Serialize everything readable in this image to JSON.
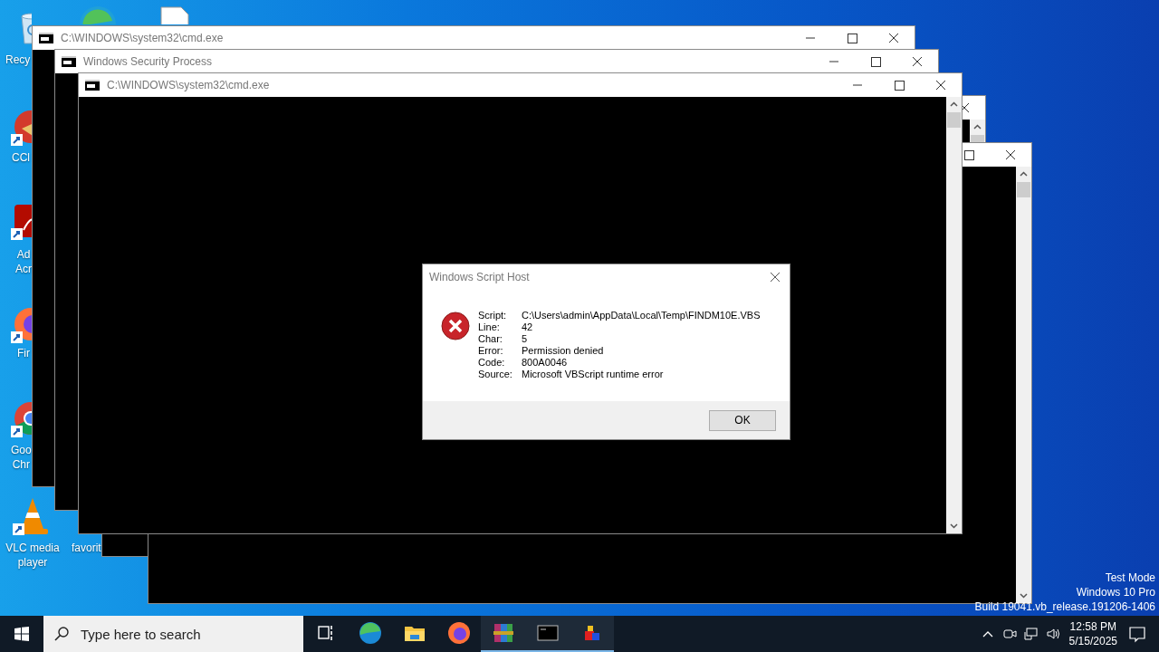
{
  "desktop_icons": [
    {
      "kind": "recycle",
      "lines": [
        "Recy"
      ]
    },
    {
      "kind": "edge"
    },
    {
      "kind": "file"
    },
    {
      "kind": "ccleaner",
      "lines": [
        "CCl"
      ]
    },
    {
      "kind": "pdf",
      "lines": [
        "Ad",
        "Acr"
      ]
    },
    {
      "kind": "firefox",
      "lines": [
        "Fir"
      ]
    },
    {
      "kind": "chrome",
      "lines": [
        "Goo",
        "Chr"
      ]
    },
    {
      "kind": "vlc",
      "lines": [
        "VLC media",
        "player"
      ]
    },
    {
      "kind": "label",
      "lines": [
        "favorit"
      ]
    }
  ],
  "windows": [
    {
      "kind": "console",
      "title": "C:\\WINDOWS\\system32\\cmd.exe"
    },
    {
      "kind": "console",
      "title": "Windows Security Process"
    },
    {
      "kind": "console"
    },
    {
      "kind": "console"
    },
    {
      "kind": "console",
      "title": "C:\\WINDOWS\\system32\\cmd.exe"
    }
  ],
  "dialog": {
    "title": "Windows Script Host",
    "fields": [
      {
        "label": "Script:",
        "value": "C:\\Users\\admin\\AppData\\Local\\Temp\\FINDM10E.VBS"
      },
      {
        "label": "Line:",
        "value": "42"
      },
      {
        "label": "Char:",
        "value": "5"
      },
      {
        "label": "Error:",
        "value": "Permission denied"
      },
      {
        "label": "Code:",
        "value": "800A0046"
      },
      {
        "label": "Source:",
        "value": "Microsoft VBScript runtime error"
      }
    ],
    "button": "OK"
  },
  "desktop_notice": [
    "Test Mode",
    "Windows 10 Pro",
    "Build 19041.vb_release.191206-1406"
  ],
  "taskbar": {
    "search": {
      "placeholder": "Type here to search"
    },
    "apps": [
      {
        "kind": "taskview",
        "running": false
      },
      {
        "kind": "edge",
        "running": false
      },
      {
        "kind": "explorer",
        "running": false
      },
      {
        "kind": "firefox",
        "running": false
      },
      {
        "kind": "winrar",
        "running": true
      },
      {
        "kind": "terminal",
        "running": true
      },
      {
        "kind": "cubes",
        "running": true
      }
    ],
    "time": "12:58 PM",
    "date": "5/15/2025"
  }
}
